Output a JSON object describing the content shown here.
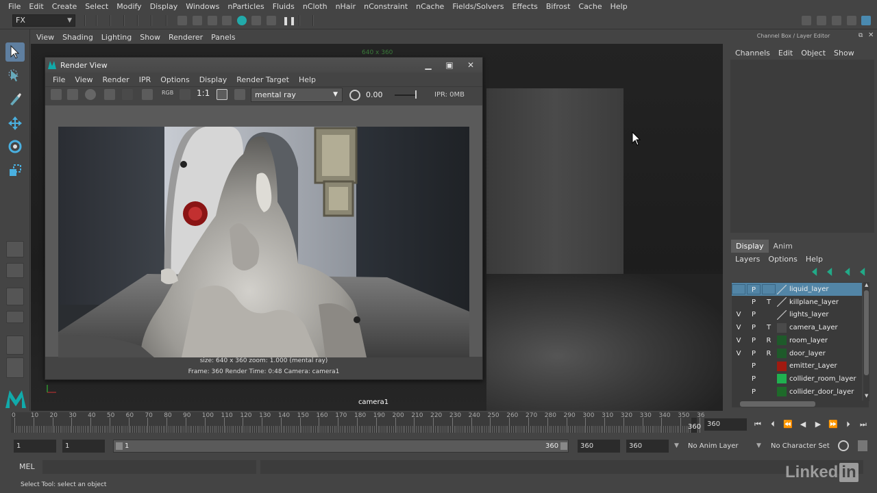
{
  "menubar": {
    "items": [
      "File",
      "Edit",
      "Create",
      "Select",
      "Modify",
      "Display",
      "Windows",
      "nParticles",
      "Fluids",
      "nCloth",
      "nHair",
      "nConstraint",
      "nCache",
      "Fields/Solvers",
      "Effects",
      "Bifrost",
      "Cache",
      "Help"
    ]
  },
  "statusline": {
    "mode": "FX"
  },
  "viewport": {
    "menu": [
      "View",
      "Shading",
      "Lighting",
      "Show",
      "Renderer",
      "Panels"
    ],
    "camera_label": "camera1",
    "resolution_label": "640 x 360"
  },
  "render_view": {
    "title": "Render View",
    "menu": [
      "File",
      "View",
      "Render",
      "IPR",
      "Options",
      "Display",
      "Render Target",
      "Help"
    ],
    "ratio": "1:1",
    "renderer": "mental ray",
    "exposure": "0.00",
    "ipr_memory": "IPR: 0MB",
    "info_line1": "size: 640 x 360  zoom: 1.000       (mental ray)",
    "info_line2": "Frame: 360       Render Time: 0:48       Camera: camera1"
  },
  "channel_box": {
    "title": "Channel Box / Layer Editor",
    "menu": [
      "Channels",
      "Edit",
      "Object",
      "Show"
    ]
  },
  "layer_editor": {
    "tabs": [
      "Display",
      "Anim"
    ],
    "active_tab": "Display",
    "menu": [
      "Layers",
      "Options",
      "Help"
    ],
    "layers": [
      {
        "v": "",
        "p": "P",
        "t": "",
        "color": "",
        "name": "liquid_layer",
        "selected": true
      },
      {
        "v": "",
        "p": "P",
        "t": "T",
        "color": "",
        "name": "killplane_layer",
        "selected": false
      },
      {
        "v": "V",
        "p": "P",
        "t": "",
        "color": "",
        "name": "lights_layer",
        "selected": false
      },
      {
        "v": "V",
        "p": "P",
        "t": "T",
        "color": "#4a4a4a",
        "name": "camera_Layer",
        "selected": false
      },
      {
        "v": "V",
        "p": "P",
        "t": "R",
        "color": "#1e5a2a",
        "name": "room_layer",
        "selected": false
      },
      {
        "v": "V",
        "p": "P",
        "t": "R",
        "color": "#1e5a2a",
        "name": "door_layer",
        "selected": false
      },
      {
        "v": "",
        "p": "P",
        "t": "",
        "color": "#a01a10",
        "name": "emitter_Layer",
        "selected": false
      },
      {
        "v": "",
        "p": "P",
        "t": "",
        "color": "#20b050",
        "name": "collider_room_layer",
        "selected": false
      },
      {
        "v": "",
        "p": "P",
        "t": "",
        "color": "#1e6a2a",
        "name": "collider_door_layer",
        "selected": false
      }
    ]
  },
  "time_slider": {
    "tick_labels": [
      "0",
      "10",
      "20",
      "30",
      "40",
      "50",
      "60",
      "70",
      "80",
      "90",
      "100",
      "110",
      "120",
      "130",
      "140",
      "150",
      "160",
      "170",
      "180",
      "190",
      "200",
      "210",
      "220",
      "230",
      "240",
      "250",
      "260",
      "270",
      "280",
      "290",
      "300",
      "310",
      "320",
      "330",
      "340",
      "350",
      "36"
    ],
    "current_frame": "360",
    "end_field": "360"
  },
  "range_slider": {
    "start": "1",
    "playback_start": "1",
    "range_start_label": "1",
    "range_end_label": "360",
    "playback_end": "360",
    "end": "360",
    "anim_layer": "No Anim Layer",
    "character_set": "No Character Set"
  },
  "command_line": {
    "label": "MEL"
  },
  "help_line": {
    "text": "Select Tool: select an object"
  },
  "watermark": {
    "text": "Linked",
    "box": "in"
  }
}
